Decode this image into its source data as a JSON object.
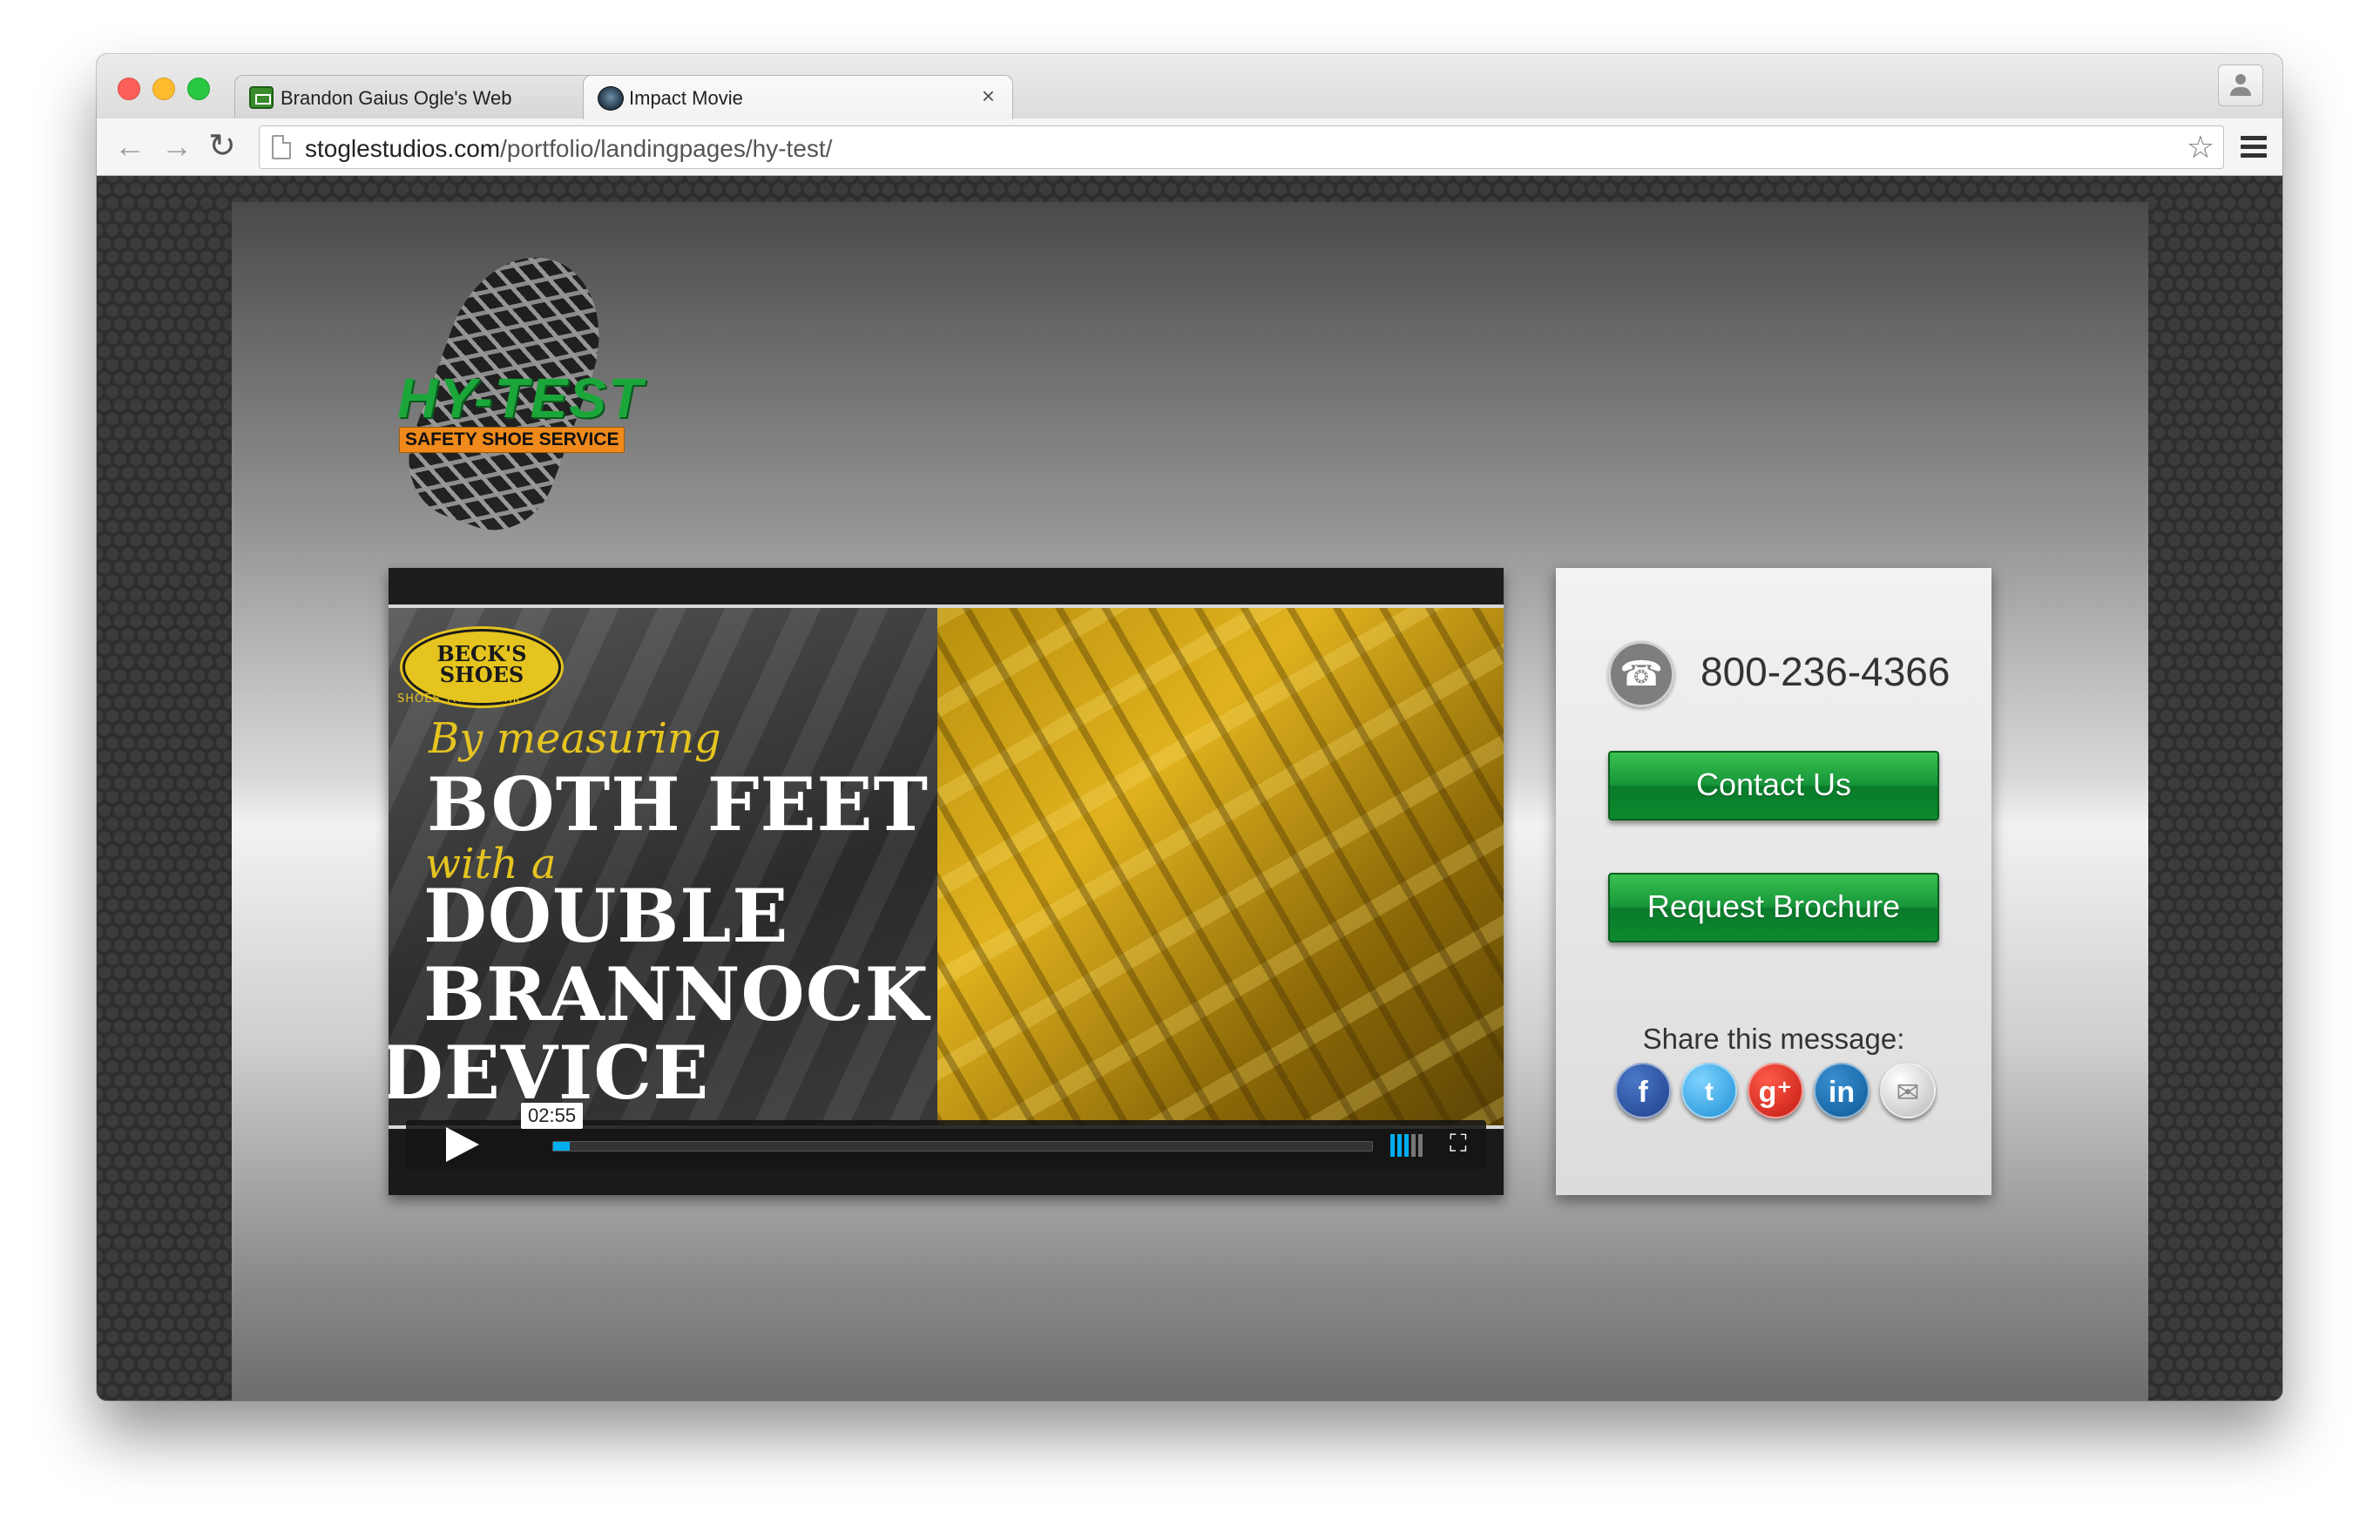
{
  "browser": {
    "tabs": [
      {
        "title": "Brandon Gaius Ogle's Web",
        "close": "×",
        "favicon": "briefcase-icon",
        "active": false
      },
      {
        "title": "Impact Movie",
        "close": "×",
        "favicon": "globe-icon",
        "active": true
      }
    ],
    "url": {
      "domain": "stoglestudios.com",
      "path": "/portfolio/landingpages/hy-test/"
    },
    "icons": {
      "back": "←",
      "forward": "→",
      "reload": "↻",
      "star": "☆"
    }
  },
  "logo": {
    "wordmark": "HY-TEST",
    "tagline": "SAFETY SHOE SERVICE",
    "color_green": "#1ba63a",
    "color_orange": "#f08a1c"
  },
  "video": {
    "brand_name": "BECK'S SHOES",
    "brand_tagline": "SHOES THAT WORK",
    "line1": "By measuring",
    "line2": "BOTH FEET",
    "line3": "with a",
    "line4": "DOUBLE",
    "line5": "BRANNOCK",
    "line6": "DEVICE",
    "duration": "02:55",
    "progress_fraction": 0.02,
    "volume_level": 3,
    "volume_max": 5,
    "accent_color": "#00adef"
  },
  "contact": {
    "phone": "800-236-4366",
    "phone_icon": "☎",
    "contact_button": "Contact Us",
    "brochure_button": "Request Brochure",
    "share_label": "Share this message:",
    "social": [
      {
        "name": "facebook",
        "glyph": "f"
      },
      {
        "name": "twitter",
        "glyph": "t"
      },
      {
        "name": "google-plus",
        "glyph": "g⁺"
      },
      {
        "name": "linkedin",
        "glyph": "in"
      },
      {
        "name": "email",
        "glyph": "✉"
      }
    ]
  }
}
